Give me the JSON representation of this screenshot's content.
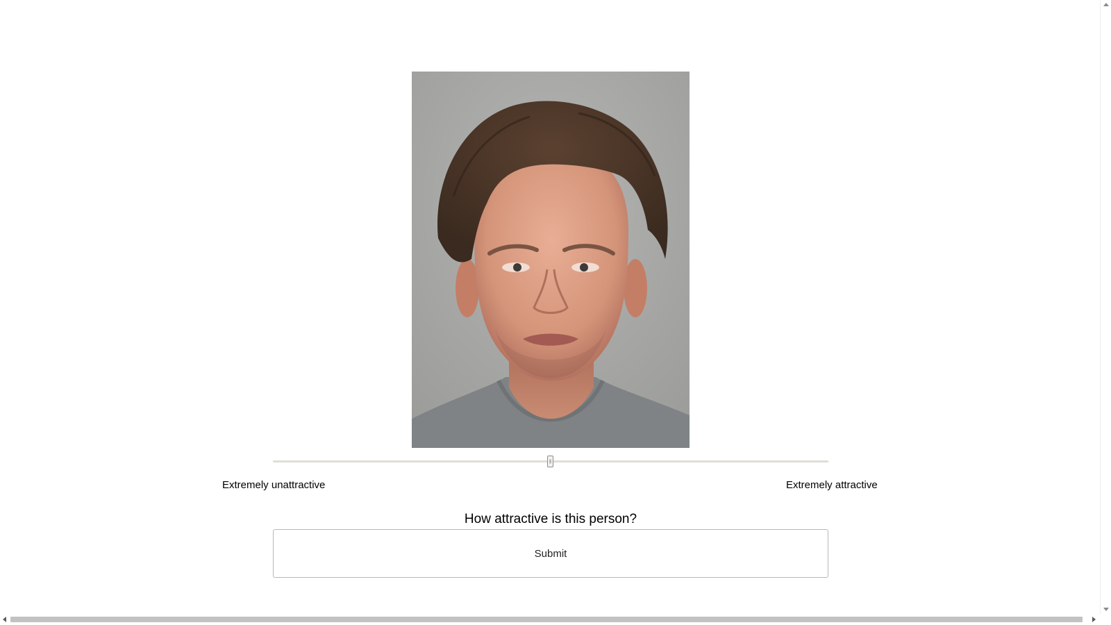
{
  "photo": {
    "alt": "Frontal face photograph of a man with brown hair wearing a grey t-shirt"
  },
  "rating": {
    "slider_value": 0.5,
    "left_label": "Extremely unattractive",
    "right_label": "Extremely attractive"
  },
  "question": "How attractive is this person?",
  "submit_label": "Submit",
  "colors": {
    "background": "#ffffff",
    "track": "#e1dcd7",
    "button_border": "#b7b7b7",
    "scroll_thumb": "#c2c2c2"
  }
}
